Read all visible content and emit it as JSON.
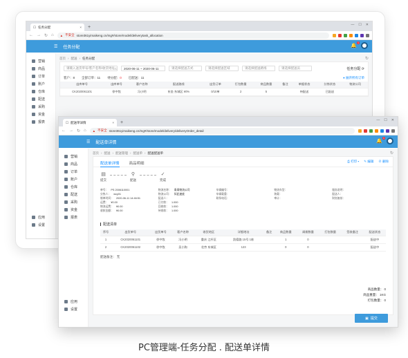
{
  "window1": {
    "tab_title": "任务分配",
    "url_warning": "不安全",
    "url": "store361yimaikeng.cn/mg#/store/model/deliverytask_allocation",
    "header_title": "任务分配",
    "breadcrumb": [
      "首页",
      "配送",
      "任务分配"
    ],
    "sidebar": [
      "营销",
      "商品",
      "订单",
      "账户",
      "仓库",
      "配送",
      "采购",
      "资金",
      "报表"
    ],
    "filters": {
      "search_placeholder": "请输入送货单号/客户名称/收货地址",
      "date_range": "2020-06-11 ~ 2020-06-11",
      "select1": "请选择配送方式",
      "select2": "请选择配送区域",
      "select3": "请选择配送路线",
      "select4": "请选择配送员"
    },
    "task_button": "任务分配",
    "stats": {
      "customer_label": "客户：",
      "customer_value": "8",
      "total_label": "全部订单：",
      "total_value": "11",
      "pending_label": "待分配：",
      "pending_value": "0",
      "assigned_label": "已配送：",
      "assigned_value": "11"
    },
    "show_all": "展开所有订单",
    "table_headers": [
      "出库单号",
      "出库单号",
      "客户名称",
      "配送路线",
      "出货订单",
      "打包数量",
      "商品数量",
      "备注",
      "单据状态",
      "分拣状态",
      "物流公司"
    ],
    "row": [
      "CK2020061101",
      "徐中牧",
      "冯小明",
      "东坐 东城区 ¥0%",
      "0/10单",
      "2",
      "5",
      "",
      "待配送",
      "已配送",
      ""
    ]
  },
  "window2": {
    "tab_title": "配送单详情",
    "url_warning": "不安全",
    "url": "store361yimaikeng.cn/mg#/store/model/delivery/deliveryOrder_detail",
    "header_title": "配送单详情",
    "breadcrumb": [
      "首页",
      "配送",
      "配送管理",
      "配送单",
      "配送配送单"
    ],
    "sidebar": [
      "营销",
      "商品",
      "订单",
      "账户",
      "仓库",
      "配送",
      "采购",
      "资金",
      "报表"
    ],
    "sidebar_bottom": [
      "应用",
      "设置"
    ],
    "tabs": [
      "配送单详情",
      "商品明细"
    ],
    "actions": [
      "打印",
      "编辑",
      "删除"
    ],
    "steps": [
      "提交",
      "配送",
      "完成"
    ],
    "info": [
      [
        "单号：",
        "PS 2006110001"
      ],
      [
        "物流名称：",
        "青青物流公司"
      ],
      [
        "车辆编号：",
        ""
      ],
      [
        "物流车型：",
        ""
      ],
      [
        "服务说明：",
        ""
      ],
      [
        "分拣人：",
        "wxy01"
      ],
      [
        "物流公司：",
        "如此速度"
      ],
      [
        "车辆载重：",
        ""
      ],
      [
        "装载：",
        ""
      ],
      [
        "配送人：",
        ""
      ],
      [
        "制单时间：",
        "2020-06-11 14:46:51"
      ],
      [
        "配送人：",
        ""
      ],
      [
        "联系电话：",
        ""
      ],
      [
        "审计：",
        ""
      ],
      [
        "财务复核：",
        ""
      ],
      [
        "运费：",
        "¥0.00"
      ],
      [
        "已付款：",
        "1.000"
      ],
      [
        "",
        ""
      ],
      [
        "",
        ""
      ],
      [
        "",
        ""
      ],
      [
        "物流运费：",
        "¥0.00"
      ],
      [
        "回收款：",
        "1.000"
      ],
      [
        "",
        ""
      ],
      [
        "",
        ""
      ],
      [
        "",
        ""
      ],
      [
        "收款金额：",
        "¥0.00"
      ],
      [
        "待收款：",
        "1.000"
      ],
      [
        "",
        ""
      ],
      [
        "",
        ""
      ],
      [
        "",
        ""
      ]
    ],
    "section_title": "配送清单",
    "table_headers": [
      "序号",
      "出货单号",
      "出货单号",
      "客户名称",
      "收货地区",
      "详细地址",
      "备注",
      "商品数量",
      "调拨数量",
      "打包数量",
      "签收备注",
      "配送状态"
    ],
    "rows": [
      [
        "1",
        "CK2020061101",
        "徐中牧",
        "冯小明",
        "重庆 江杆区",
        "凯德路 15号 1栋",
        "",
        "1",
        "0",
        "",
        "",
        "配送中"
      ],
      [
        "2",
        "CK2020061102",
        "徐中牧",
        "吴小狗",
        "北京 东城区",
        "123",
        "",
        "0",
        "0",
        "",
        "",
        "配送中"
      ]
    ],
    "remark_label": "配送备注：",
    "remark_value": "无",
    "totals": [
      {
        "label": "商品数量：",
        "value": "0"
      },
      {
        "label": "商品重量：",
        "value": "1KG"
      },
      {
        "label": "打包数量：",
        "value": "0"
      }
    ],
    "submit": "提交"
  },
  "caption": "PC管理端-任务分配 . 配送单详情",
  "colors": {
    "brand": "#3e9bdc",
    "link": "#1890ff",
    "alert": "#f5222d"
  }
}
